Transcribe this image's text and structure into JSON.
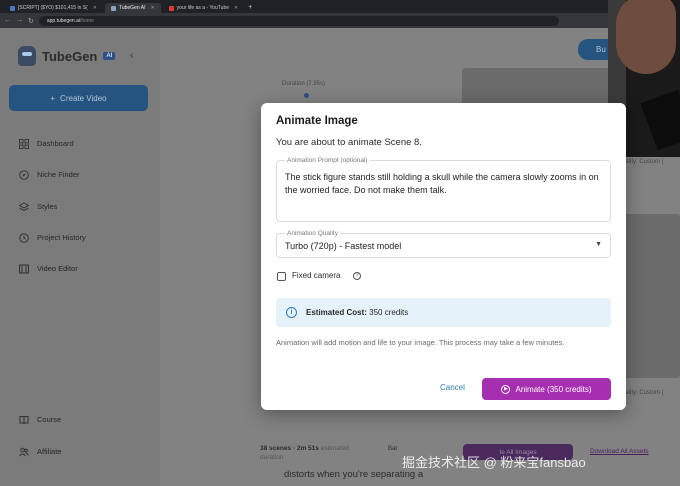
{
  "browser": {
    "tabs": [
      {
        "label": "[SCRIPT] ($YO) $101,415 in S(",
        "color": "#4a78c7",
        "active": false
      },
      {
        "label": "TubeGen AI",
        "color": "#8aa2c8",
        "active": true
      },
      {
        "label": "your life as a - YouTube",
        "color": "#e33b2e",
        "active": false
      }
    ],
    "url_host": "app.tubegen.ai",
    "url_path": "/home"
  },
  "sidebar": {
    "brand": "TubeGen",
    "badge": "AI",
    "collapse_icon": "chevron-left-icon",
    "create_label": "Create Video",
    "items": [
      {
        "label": "Dashboard",
        "icon": "grid-icon"
      },
      {
        "label": "Niche Finder",
        "icon": "compass-icon"
      },
      {
        "label": "Styles",
        "icon": "layers-icon"
      },
      {
        "label": "Project History",
        "icon": "history-icon"
      },
      {
        "label": "Video Editor",
        "icon": "film-icon"
      }
    ],
    "bottom_items": [
      {
        "label": "Course",
        "icon": "book-icon"
      },
      {
        "label": "Affiliate",
        "icon": "users-icon"
      }
    ]
  },
  "main": {
    "top_button": "Bu",
    "duration_label": "Duration (7.95s)",
    "quality_note_1": "uality: Custom (",
    "quality_note_2": "uality: Custom (",
    "scenes_text": "38 scenes · 2m 51s",
    "estimated_text": "estimated duration",
    "btn_bar": "Bat",
    "btn_all": "te All Images",
    "btn_download": "Download All Assets",
    "script_line": "distorts when you're separating a"
  },
  "modal": {
    "title": "Animate Image",
    "subtitle": "You are about to animate Scene 8.",
    "prompt_label": "Animation Prompt (optional)",
    "prompt_value": "The stick figure stands still holding a skull while the camera slowly zooms in on the worried face. Do not make them talk.",
    "quality_label": "Animation Quality",
    "quality_value": "Turbo (720p) - Fastest model",
    "fixed_camera_label": "Fixed camera",
    "fixed_camera_checked": false,
    "cost_label": "Estimated Cost:",
    "cost_value": "350 credits",
    "info_text": "Animation will add motion and life to your image. This process may take a few minutes.",
    "cancel_label": "Cancel",
    "animate_label": "Animate (350 credits)"
  },
  "colors": {
    "accent_purple": "#a62fb1",
    "accent_blue": "#2e7fb0",
    "info_bg": "#e6f2fa"
  },
  "watermark": "掘金技术社区 @ 粉来宝fansbao"
}
